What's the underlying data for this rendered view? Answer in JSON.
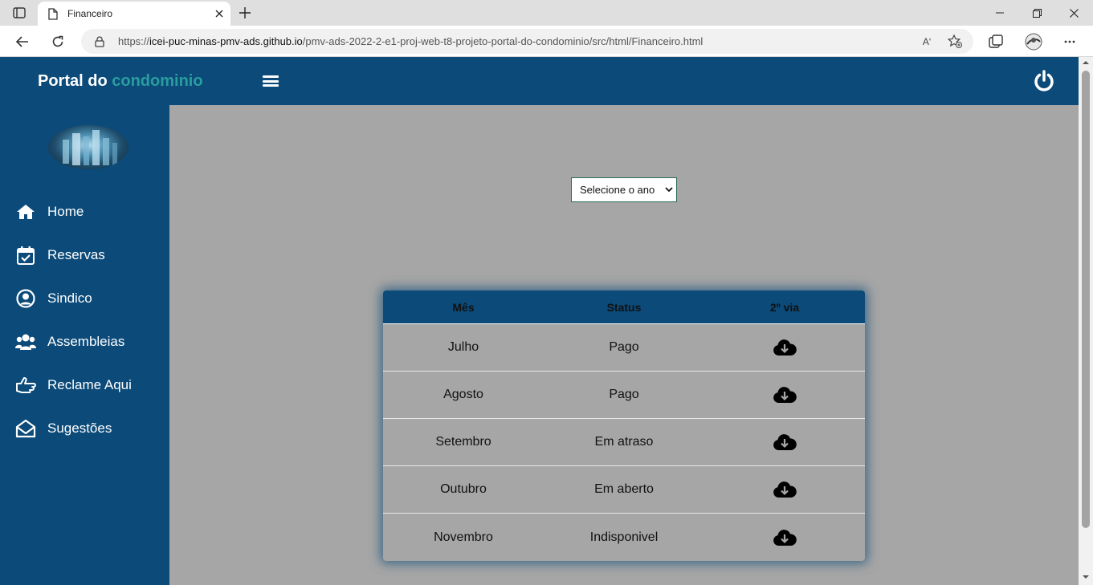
{
  "browser": {
    "tab_title": "Financeiro",
    "url_prefix": "https://",
    "url_host": "icei-puc-minas-pmv-ads.github.io",
    "url_path": "/pmv-ads-2022-2-e1-proj-web-t8-projeto-portal-do-condominio/src/html/Financeiro.html",
    "read_aloud_label": "Aʹ"
  },
  "header": {
    "brand_main": "Portal do ",
    "brand_accent": "condominio",
    "accent_color": "#2a9d9f",
    "primary_color": "#0b4a79"
  },
  "sidebar": {
    "items": [
      {
        "label": "Home",
        "icon": "home-icon"
      },
      {
        "label": "Reservas",
        "icon": "calendar-check-icon"
      },
      {
        "label": "Sindico",
        "icon": "user-circle-icon"
      },
      {
        "label": "Assembleias",
        "icon": "users-icon"
      },
      {
        "label": "Reclame Aqui",
        "icon": "hand-point-icon"
      },
      {
        "label": "Sugestões",
        "icon": "envelope-open-icon"
      }
    ]
  },
  "filter": {
    "year_select": "Selecione o ano"
  },
  "table": {
    "headers": [
      "Mês",
      "Status",
      "2º via"
    ],
    "rows": [
      {
        "mes": "Julho",
        "status": "Pago"
      },
      {
        "mes": "Agosto",
        "status": "Pago"
      },
      {
        "mes": "Setembro",
        "status": "Em atraso"
      },
      {
        "mes": "Outubro",
        "status": "Em aberto"
      },
      {
        "mes": "Novembro",
        "status": "Indisponivel"
      }
    ],
    "download_icon": "cloud-download-icon"
  }
}
